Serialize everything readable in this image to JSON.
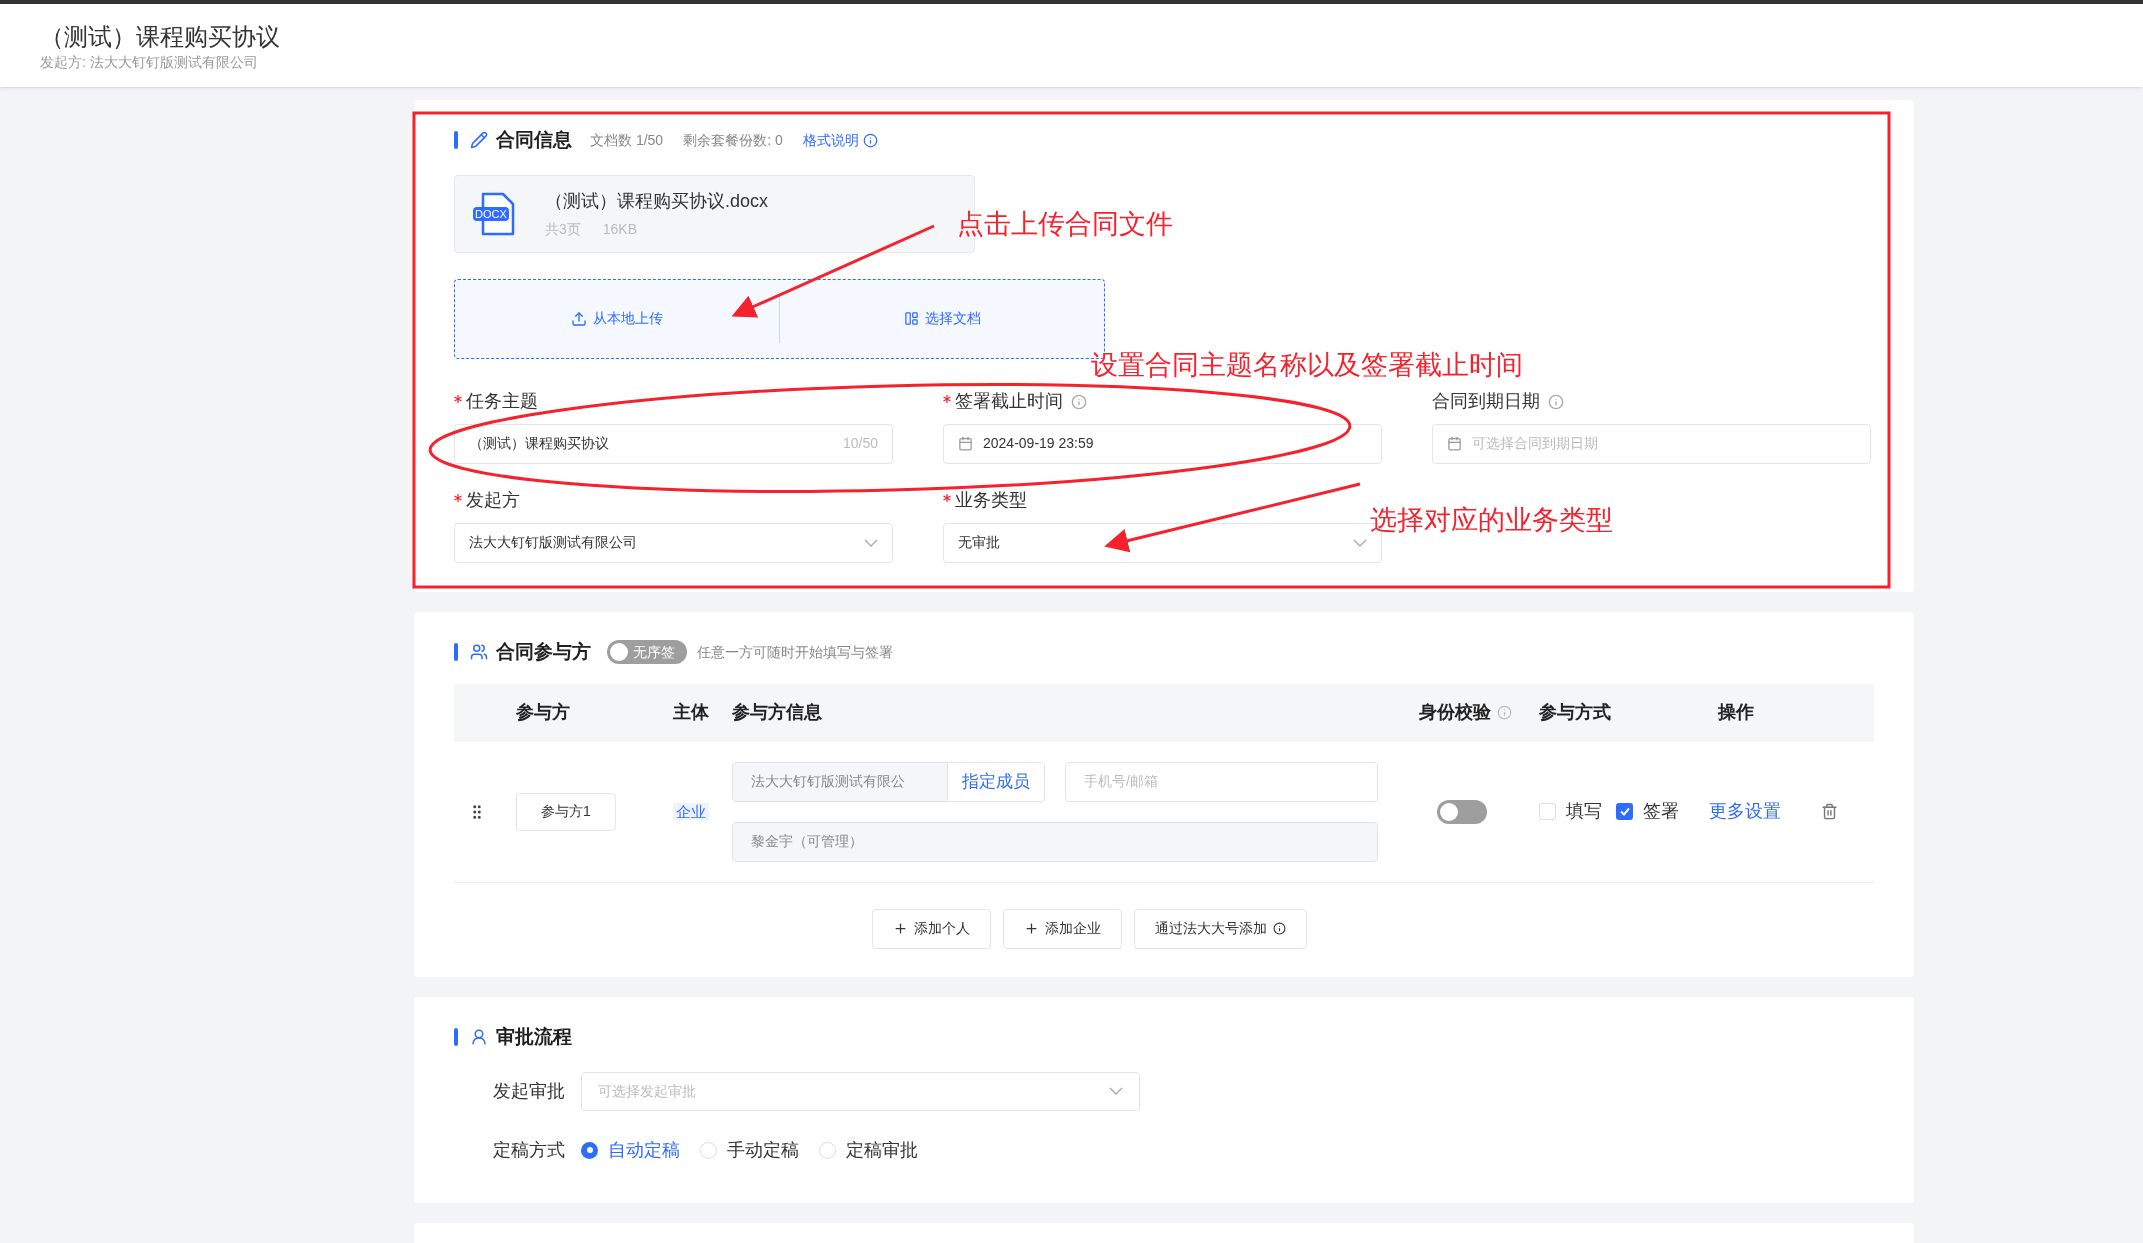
{
  "header": {
    "title": "（测试）课程购买协议",
    "subtitle": "发起方: 法大大钉钉版测试有限公司"
  },
  "contract_info": {
    "title": "合同信息",
    "doc_count": "文档数 1/50",
    "remaining": "剩余套餐份数: 0",
    "format_link": "格式说明",
    "file": {
      "badge": "DOCX",
      "name": "（测试）课程购买协议.docx",
      "pages": "共3页",
      "size": "16KB"
    },
    "upload_buttons": [
      {
        "kind": "upload",
        "label": "从本地上传"
      },
      {
        "kind": "choose",
        "label": "选择文档"
      }
    ],
    "fields": [
      {
        "label": "任务主题",
        "required": true,
        "info": false,
        "kind": "text",
        "value": "（测试）课程购买协议",
        "counter": "10/50"
      },
      {
        "label": "签署截止时间",
        "required": true,
        "info": true,
        "kind": "date",
        "value": "2024-09-19 23:59"
      },
      {
        "label": "合同到期日期",
        "required": false,
        "info": true,
        "kind": "date",
        "placeholder": "可选择合同到期日期"
      },
      {
        "label": "发起方",
        "required": true,
        "info": false,
        "kind": "select",
        "value": "法大大钉钉版测试有限公司"
      },
      {
        "label": "业务类型",
        "required": true,
        "info": false,
        "kind": "select",
        "value": "无审批"
      }
    ]
  },
  "participants": {
    "title": "合同参与方",
    "order_toggle": {
      "label": "无序签",
      "on": false
    },
    "hint": "任意一方可随时开始填写与签署",
    "columns": [
      {
        "label": "参与方",
        "info": false
      },
      {
        "label": "主体",
        "info": false
      },
      {
        "label": "参与方信息",
        "info": false
      },
      {
        "label": "身份校验",
        "info": true
      },
      {
        "label": "参与方式",
        "info": false
      },
      {
        "label": "操作",
        "info": false
      }
    ],
    "rows": [
      {
        "name": "参与方1",
        "entity": "企业",
        "company": "法大大钉钉版测试有限公",
        "assign_button": "指定成员",
        "contact_placeholder": "手机号/邮箱",
        "member": "黎金宇（可管理）",
        "id_check": false,
        "modes": [
          {
            "label": "填写",
            "checked": false
          },
          {
            "label": "签署",
            "checked": true
          }
        ],
        "more": "更多设置"
      }
    ],
    "add_buttons": [
      {
        "kind": "plus",
        "label": "添加个人",
        "info": false
      },
      {
        "kind": "plus",
        "label": "添加企业",
        "info": false
      },
      {
        "kind": "plain",
        "label": "通过法大大号添加",
        "info": true
      }
    ]
  },
  "approval": {
    "title": "审批流程",
    "initiate": {
      "label": "发起审批",
      "placeholder": "可选择发起审批"
    },
    "finalize": {
      "label": "定稿方式",
      "options": [
        {
          "label": "自动定稿",
          "selected": true
        },
        {
          "label": "手动定稿",
          "selected": false
        },
        {
          "label": "定稿审批",
          "selected": false
        }
      ]
    }
  },
  "annotations": [
    {
      "text": "点击上传合同文件"
    },
    {
      "text": "设置合同主题名称以及签署截止时间"
    },
    {
      "text": "选择对应的业务类型"
    }
  ]
}
